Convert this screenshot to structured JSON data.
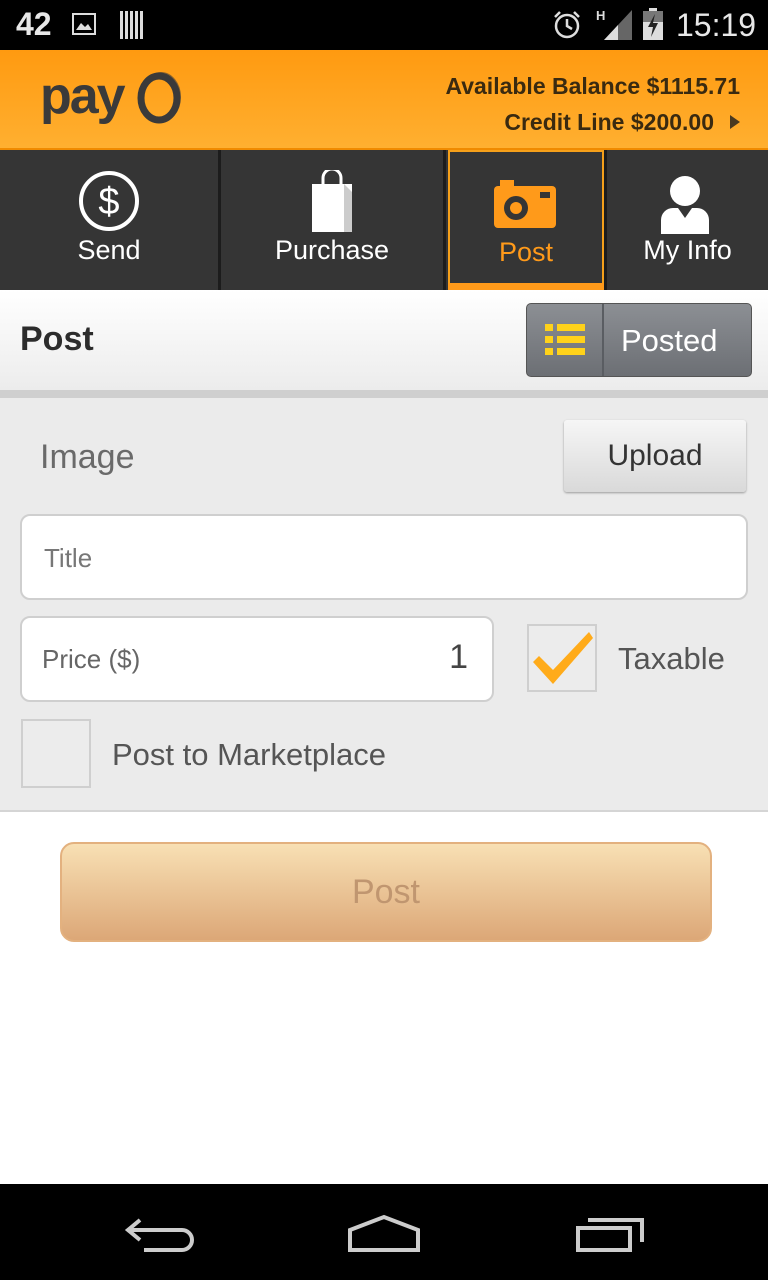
{
  "status_bar": {
    "notification_count": "42",
    "time": "15:19",
    "network_type": "H",
    "icons": [
      "image-icon",
      "barcode-icon",
      "alarm-icon",
      "signal-icon",
      "battery-icon"
    ]
  },
  "header": {
    "logo_text": "pay",
    "available_balance": "Available Balance $1115.71",
    "credit_line": "Credit Line $200.00",
    "accent_color": "#ff9a10"
  },
  "tabs": [
    {
      "label": "Send",
      "icon": "dollar-circle-icon",
      "active": false
    },
    {
      "label": "Purchase",
      "icon": "shopping-bag-icon",
      "active": false
    },
    {
      "label": "Post",
      "icon": "camera-icon",
      "active": true
    },
    {
      "label": "My Info",
      "icon": "person-icon",
      "active": false
    }
  ],
  "section": {
    "title": "Post",
    "posted_button_label": "Posted",
    "posted_icon": "list-icon"
  },
  "form": {
    "image_label": "Image",
    "upload_label": "Upload",
    "title_placeholder": "Title",
    "title_value": "",
    "price_placeholder": "Price ($)",
    "price_value": "1",
    "taxable_label": "Taxable",
    "taxable_checked": true,
    "marketplace_label": "Post to Marketplace",
    "marketplace_checked": false
  },
  "actions": {
    "post_label": "Post"
  },
  "nav_bar": {
    "icons": [
      "back-icon",
      "home-icon",
      "recent-apps-icon"
    ]
  }
}
